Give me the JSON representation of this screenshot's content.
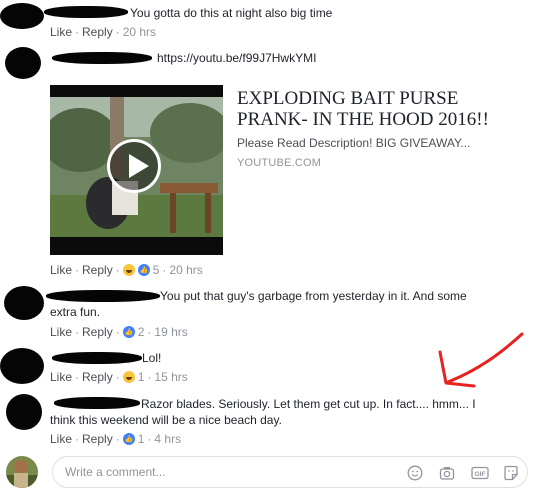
{
  "comments": [
    {
      "text": "You gotta do this at night also big time",
      "like": "Like",
      "reply": "Reply",
      "time": "20 hrs"
    },
    {
      "link_url": "https://youtu.be/f99J7HwkYMI",
      "link_title": "EXPLODING BAIT PURSE PRANK- IN THE HOOD 2016!!",
      "link_description": "Please Read Description! BIG GIVEAWAY...",
      "link_domain": "YOUTUBE.COM",
      "like": "Like",
      "reply": "Reply",
      "reaction_count": "5",
      "time": "20 hrs",
      "reactions": [
        "haha",
        "like"
      ]
    },
    {
      "text_line1": "You put that guy's garbage from yesterday in it. And some",
      "text_line2": "extra fun.",
      "like": "Like",
      "reply": "Reply",
      "reaction_count": "2",
      "time": "19 hrs",
      "reactions": [
        "like"
      ]
    },
    {
      "text": "Lol!",
      "like": "Like",
      "reply": "Reply",
      "reaction_count": "1",
      "time": "15 hrs",
      "reactions": [
        "haha"
      ]
    },
    {
      "text_line1": "Razor blades. Seriously. Let them get cut up. In fact.... hmm... I",
      "text_line2": "think this weekend will be a nice beach day.",
      "like": "Like",
      "reply": "Reply",
      "reaction_count": "1",
      "time": "4 hrs",
      "reactions": [
        "like"
      ]
    }
  ],
  "composer": {
    "placeholder": "Write a comment...",
    "icons": [
      "emoji-icon",
      "camera-icon",
      "gif-icon",
      "sticker-icon"
    ]
  },
  "colors": {
    "meta_gray": "#90949c",
    "link_gray": "#4b4f56",
    "like_blue": "#4080ff",
    "haha_yellow": "#f7c53a",
    "annotation_red": "#e8231f"
  }
}
